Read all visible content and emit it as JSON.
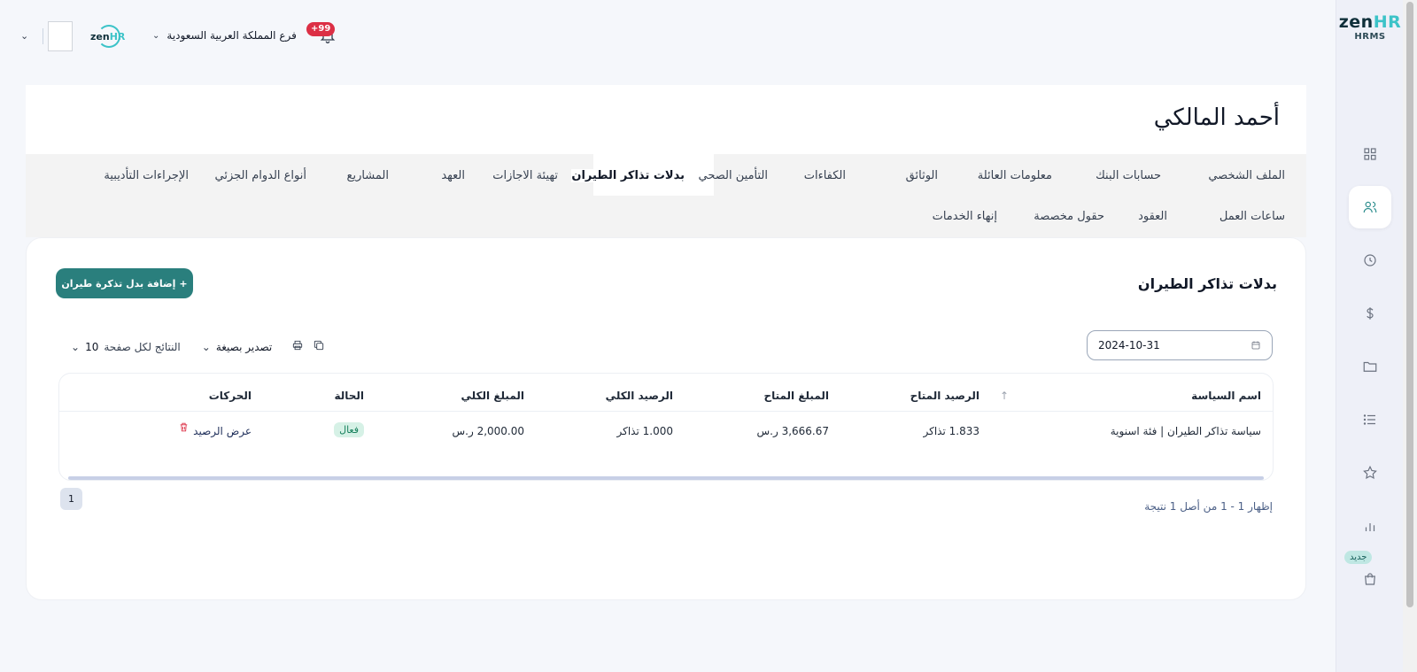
{
  "logo": {
    "brand_main": "zen",
    "brand_accent": "HR",
    "sub": "HRMS"
  },
  "topbar": {
    "notification_count": "+99",
    "branch": "فرع المملكة العربية السعودية",
    "company_logo_main": "zen",
    "company_logo_accent": "HR"
  },
  "sidebar": {
    "items": [
      {
        "icon": "dashboard-icon"
      },
      {
        "icon": "users-icon"
      },
      {
        "icon": "clock-icon"
      },
      {
        "icon": "dollar-icon"
      },
      {
        "icon": "folder-icon"
      },
      {
        "icon": "list-icon"
      },
      {
        "icon": "star-icon"
      },
      {
        "icon": "chart-icon"
      },
      {
        "icon": "bag-icon"
      }
    ],
    "new_badge": "جديد"
  },
  "employee": {
    "name": "أحمد المالكي"
  },
  "tabs": [
    {
      "label": "الملف الشخصي"
    },
    {
      "label": "حسابات البنك"
    },
    {
      "label": "معلومات العائلة"
    },
    {
      "label": "الوثائق"
    },
    {
      "label": "الكفاءات"
    },
    {
      "label": "التأمين الصحي"
    },
    {
      "label": "بدلات تذاكر الطيران"
    },
    {
      "label": "تهيئة الاجازات"
    },
    {
      "label": "العهد"
    },
    {
      "label": "المشاريع"
    },
    {
      "label": "أنواع الدوام الجزئي"
    },
    {
      "label": "الإجراءات التأديبية"
    },
    {
      "label": "ساعات العمل"
    },
    {
      "label": "العقود"
    },
    {
      "label": "حقول مخصصة"
    },
    {
      "label": "إنهاء الخدمات"
    }
  ],
  "section": {
    "title": "بدلات تذاكر الطيران",
    "add_button": "إضافة بدل تذكرة طيران",
    "date_value": "2024-10-31",
    "export_label": "تصدير بصيغة",
    "per_page_label": "النتائج لكل صفحة",
    "per_page_value": "10"
  },
  "table": {
    "headers": [
      "اسم السياسة",
      "الرصيد المتاح",
      "المبلغ المتاح",
      "الرصيد الكلي",
      "المبلغ الكلي",
      "الحالة",
      "الحركات"
    ],
    "rows": [
      {
        "policy": "سياسة تذاكر الطيران | فئة اسنوية",
        "available_balance": "1.833 تذاكر",
        "available_amount": "3,666.67 ر.س",
        "total_balance": "1.000 تذاكر",
        "total_amount": "2,000.00 ر.س",
        "status": "فعال",
        "action": "عرض الرصيد"
      }
    ]
  },
  "pagination": {
    "info": "إظهار 1 - 1 من أصل 1 نتيجة",
    "current_page": "1"
  },
  "colors": {
    "primary": "#2a7f7d",
    "accent": "#3cc3c8",
    "danger": "#dc2f45",
    "status_active_bg": "#d6f1e6"
  }
}
